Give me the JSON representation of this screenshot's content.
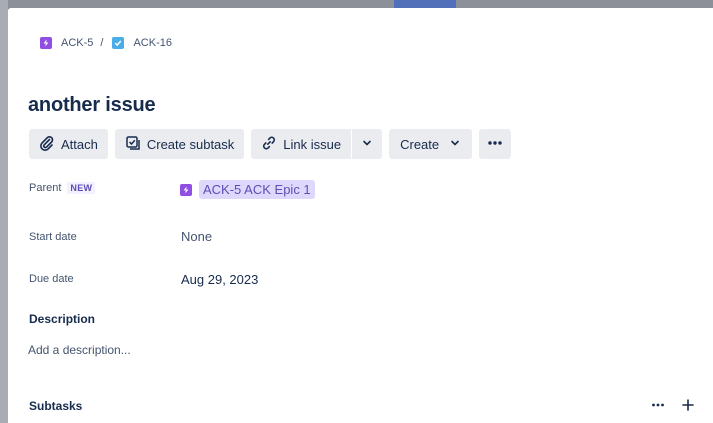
{
  "breadcrumb": {
    "items": [
      {
        "key": "ACK-5",
        "icon": "epic-icon"
      },
      {
        "key": "ACK-16",
        "icon": "task-icon"
      }
    ],
    "separator": "/"
  },
  "issue": {
    "title": "another issue"
  },
  "toolbar": {
    "attach_label": "Attach",
    "create_subtask_label": "Create subtask",
    "link_issue_label": "Link issue",
    "create_label": "Create"
  },
  "fields": {
    "parent": {
      "label": "Parent",
      "badge": "NEW",
      "value": "ACK-5 ACK Epic 1"
    },
    "start_date": {
      "label": "Start date",
      "value": "None"
    },
    "due_date": {
      "label": "Due date",
      "value": "Aug 29, 2023"
    }
  },
  "description": {
    "title": "Description",
    "placeholder": "Add a description..."
  },
  "subtasks": {
    "title": "Subtasks"
  },
  "colors": {
    "accent_epic": "#904ee2",
    "task": "#4bade8",
    "lozenge_bg": "#dfd8fd",
    "button_bg": "#ebecf0"
  }
}
